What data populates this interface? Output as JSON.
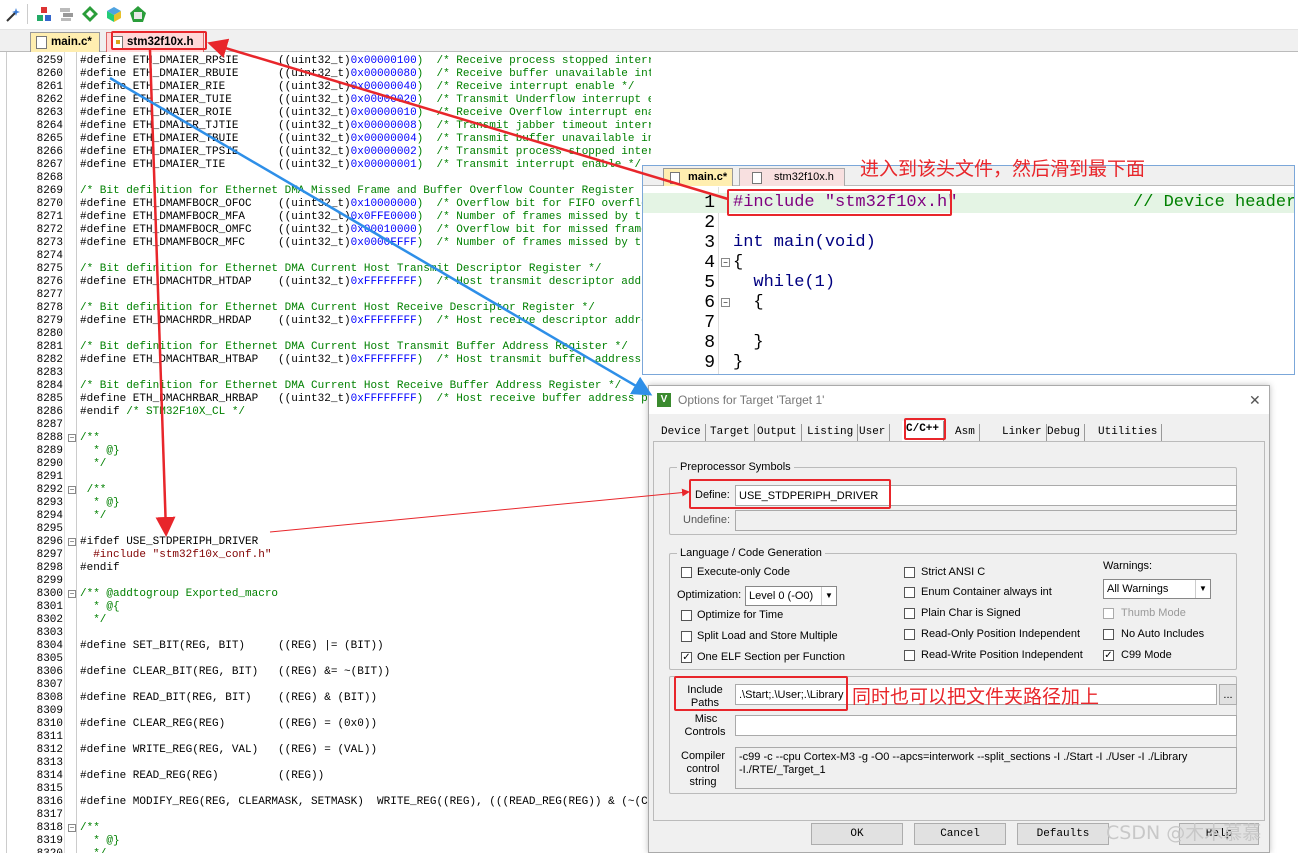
{
  "tabs": [
    {
      "label": "main.c*"
    },
    {
      "label": "stm32f10x.h"
    }
  ],
  "code_lines": [
    {
      "n": "8259",
      "t": "#define ETH_DMAIER_RPSIE      ((uint32_t)",
      "h": "0x00000100",
      "c": ")  /* Receive process stopped interrupt enable */"
    },
    {
      "n": "8260",
      "t": "#define ETH_DMAIER_RBUIE      ((uint32_t)",
      "h": "0x00000080",
      "c": ")  /* Receive buffer unavailable interrupt enable */"
    },
    {
      "n": "8261",
      "t": "#define ETH_DMAIER_RIE        ((uint32_t)",
      "h": "0x00000040",
      "c": ")  /* Receive interrupt enable */"
    },
    {
      "n": "8262",
      "t": "#define ETH_DMAIER_TUIE       ((uint32_t)",
      "h": "0x00000020",
      "c": ")  /* Transmit Underflow interrupt enable */"
    },
    {
      "n": "8263",
      "t": "#define ETH_DMAIER_ROIE       ((uint32_t)",
      "h": "0x00000010",
      "c": ")  /* Receive Overflow interrupt enable */"
    },
    {
      "n": "8264",
      "t": "#define ETH_DMAIER_TJTIE      ((uint32_t)",
      "h": "0x00000008",
      "c": ")  /* Transmit jabber timeout interrupt enable */"
    },
    {
      "n": "8265",
      "t": "#define ETH_DMAIER_TBUIE      ((uint32_t)",
      "h": "0x00000004",
      "c": ")  /* Transmit buffer unavailable interrupt enable */"
    },
    {
      "n": "8266",
      "t": "#define ETH_DMAIER_TPSIE      ((uint32_t)",
      "h": "0x00000002",
      "c": ")  /* Transmit process stopped interrupt enable */"
    },
    {
      "n": "8267",
      "t": "#define ETH_DMAIER_TIE        ((uint32_t)",
      "h": "0x00000001",
      "c": ")  /* Transmit interrupt enable */"
    },
    {
      "n": "8268",
      "t": "",
      "h": "",
      "c": ""
    },
    {
      "n": "8269",
      "t": "",
      "h": "",
      "c": "/* Bit definition for Ethernet DMA Missed Frame and Buffer Overflow Counter Register */"
    },
    {
      "n": "8270",
      "t": "#define ETH_DMAMFBOCR_OFOC    ((uint32_t)",
      "h": "0x10000000",
      "c": ")  /* Overflow bit for FIFO overflow counter */"
    },
    {
      "n": "8271",
      "t": "#define ETH_DMAMFBOCR_MFA     ((uint32_t)",
      "h": "0x0FFE0000",
      "c": ")  /* Number of frames missed by the application */"
    },
    {
      "n": "8272",
      "t": "#define ETH_DMAMFBOCR_OMFC    ((uint32_t)",
      "h": "0x00010000",
      "c": ")  /* Overflow bit for missed frame counter */"
    },
    {
      "n": "8273",
      "t": "#define ETH_DMAMFBOCR_MFC     ((uint32_t)",
      "h": "0x0000FFFF",
      "c": ")  /* Number of frames missed by the controller */"
    },
    {
      "n": "8274",
      "t": "",
      "h": "",
      "c": ""
    },
    {
      "n": "8275",
      "t": "",
      "h": "",
      "c": "/* Bit definition for Ethernet DMA Current Host Transmit Descriptor Register */"
    },
    {
      "n": "8276",
      "t": "#define ETH_DMACHTDR_HTDAP    ((uint32_t)",
      "h": "0xFFFFFFFF",
      "c": ")  /* Host transmit descriptor address pointer */"
    },
    {
      "n": "8277",
      "t": "",
      "h": "",
      "c": ""
    },
    {
      "n": "8278",
      "t": "",
      "h": "",
      "c": "/* Bit definition for Ethernet DMA Current Host Receive Descriptor Register */"
    },
    {
      "n": "8279",
      "t": "#define ETH_DMACHRDR_HRDAP    ((uint32_t)",
      "h": "0xFFFFFFFF",
      "c": ")  /* Host receive descriptor address pointer */"
    },
    {
      "n": "8280",
      "t": "",
      "h": "",
      "c": ""
    },
    {
      "n": "8281",
      "t": "",
      "h": "",
      "c": "/* Bit definition for Ethernet DMA Current Host Transmit Buffer Address Register */"
    },
    {
      "n": "8282",
      "t": "#define ETH_DMACHTBAR_HTBAP   ((uint32_t)",
      "h": "0xFFFFFFFF",
      "c": ")  /* Host transmit buffer address pointer */"
    },
    {
      "n": "8283",
      "t": "",
      "h": "",
      "c": ""
    },
    {
      "n": "8284",
      "t": "",
      "h": "",
      "c": "/* Bit definition for Ethernet DMA Current Host Receive Buffer Address Register */"
    },
    {
      "n": "8285",
      "t": "#define ETH_DMACHRBAR_HRBAP   ((uint32_t)",
      "h": "0xFFFFFFFF",
      "c": ")  /* Host receive buffer address pointer */"
    },
    {
      "n": "8286",
      "t": "#endif ",
      "h": "",
      "c": "/* STM32F10X_CL */"
    },
    {
      "n": "8287",
      "t": "",
      "h": "",
      "c": ""
    },
    {
      "n": "8288",
      "t": "/**",
      "h": "",
      "c": ""
    },
    {
      "n": "8289",
      "t": "  * @}",
      "h": "",
      "c": ""
    },
    {
      "n": "8290",
      "t": "  */",
      "h": "",
      "c": ""
    },
    {
      "n": "8291",
      "t": "",
      "h": "",
      "c": ""
    },
    {
      "n": "8292",
      "t": " /**",
      "h": "",
      "c": ""
    },
    {
      "n": "8293",
      "t": "  * @}",
      "h": "",
      "c": ""
    },
    {
      "n": "8294",
      "t": "  */",
      "h": "",
      "c": ""
    },
    {
      "n": "8295",
      "t": "",
      "h": "",
      "c": ""
    },
    {
      "n": "8296",
      "t": "#ifdef USE_STDPERIPH_DRIVER",
      "h": "",
      "c": ""
    },
    {
      "n": "8297",
      "t": "  #include \"stm32f10x_conf.h\"",
      "h": "",
      "c": ""
    },
    {
      "n": "8298",
      "t": "#endif",
      "h": "",
      "c": ""
    },
    {
      "n": "8299",
      "t": "",
      "h": "",
      "c": ""
    },
    {
      "n": "8300",
      "t": "/** @addtogroup Exported_macro",
      "h": "",
      "c": ""
    },
    {
      "n": "8301",
      "t": "  * @{",
      "h": "",
      "c": ""
    },
    {
      "n": "8302",
      "t": "  */",
      "h": "",
      "c": ""
    },
    {
      "n": "8303",
      "t": "",
      "h": "",
      "c": ""
    },
    {
      "n": "8304",
      "t": "#define SET_BIT(REG, BIT)     ((REG) |= (BIT))",
      "h": "",
      "c": ""
    },
    {
      "n": "8305",
      "t": "",
      "h": "",
      "c": ""
    },
    {
      "n": "8306",
      "t": "#define CLEAR_BIT(REG, BIT)   ((REG) &= ~(BIT))",
      "h": "",
      "c": ""
    },
    {
      "n": "8307",
      "t": "",
      "h": "",
      "c": ""
    },
    {
      "n": "8308",
      "t": "#define READ_BIT(REG, BIT)    ((REG) & (BIT))",
      "h": "",
      "c": ""
    },
    {
      "n": "8309",
      "t": "",
      "h": "",
      "c": ""
    },
    {
      "n": "8310",
      "t": "#define CLEAR_REG(REG)        ((REG) = (0x0))",
      "h": "",
      "c": ""
    },
    {
      "n": "8311",
      "t": "",
      "h": "",
      "c": ""
    },
    {
      "n": "8312",
      "t": "#define WRITE_REG(REG, VAL)   ((REG) = (VAL))",
      "h": "",
      "c": ""
    },
    {
      "n": "8313",
      "t": "",
      "h": "",
      "c": ""
    },
    {
      "n": "8314",
      "t": "#define READ_REG(REG)         ((REG))",
      "h": "",
      "c": ""
    },
    {
      "n": "8315",
      "t": "",
      "h": "",
      "c": ""
    },
    {
      "n": "8316",
      "t": "#define MODIFY_REG(REG, CLEARMASK, SETMASK)  WRITE_REG((REG), (((READ_REG(REG)) & (~(CLEARMASK))) | (SETMASK)))",
      "h": "",
      "c": ""
    },
    {
      "n": "8317",
      "t": "",
      "h": "",
      "c": ""
    },
    {
      "n": "8318",
      "t": "/**",
      "h": "",
      "c": ""
    },
    {
      "n": "8319",
      "t": "  * @}",
      "h": "",
      "c": ""
    },
    {
      "n": "8320",
      "t": "  */",
      "h": "",
      "c": ""
    }
  ],
  "win2": {
    "tabs": [
      "main.c*",
      "stm32f10x.h"
    ],
    "lines": [
      {
        "n": "1",
        "t": "#include \"stm32f10x.h\"",
        "c": "// Device header"
      },
      {
        "n": "2",
        "t": "",
        "c": ""
      },
      {
        "n": "3",
        "t": "int main(void)",
        "c": ""
      },
      {
        "n": "4",
        "t": "{",
        "c": ""
      },
      {
        "n": "5",
        "t": "  while(1)",
        "c": ""
      },
      {
        "n": "6",
        "t": "  {",
        "c": ""
      },
      {
        "n": "7",
        "t": "",
        "c": ""
      },
      {
        "n": "8",
        "t": "  }",
        "c": ""
      },
      {
        "n": "9",
        "t": "}",
        "c": ""
      }
    ]
  },
  "annotations": {
    "scroll_note": "进入到该头文件，然后滑到最下面",
    "path_note": "同时也可以把文件夹路径加上"
  },
  "dialog": {
    "title": "Options for Target 'Target 1'",
    "close": "✕",
    "tabs": [
      "Device",
      "Target",
      "Output",
      "Listing",
      "User",
      "C/C++",
      "Asm",
      "Linker",
      "Debug",
      "Utilities"
    ],
    "preproc_group": "Preprocessor Symbols",
    "define_label": "Define:",
    "define_value": "USE_STDPERIPH_DRIVER",
    "undefine_label": "Undefine:",
    "undefine_value": "",
    "langgen_group": "Language / Code Generation",
    "execute_only": "Execute-only Code",
    "optimization_label": "Optimization:",
    "optimization_value": "Level 0 (-O0)",
    "optimize_time": "Optimize for Time",
    "split_load": "Split Load and Store Multiple",
    "one_elf": "One ELF Section per Function",
    "strict_ansi": "Strict ANSI C",
    "enum_container": "Enum Container always int",
    "plain_char": "Plain Char is Signed",
    "ro_pos": "Read-Only Position Independent",
    "rw_pos": "Read-Write Position Independent",
    "warnings_label": "Warnings:",
    "warnings_value": "All Warnings",
    "thumb_mode": "Thumb Mode",
    "no_auto": "No Auto Includes",
    "c99": "C99 Mode",
    "include_label1": "Include",
    "include_label2": "Paths",
    "include_value": ".\\Start;.\\User;.\\Library",
    "browse": "...",
    "misc_label1": "Misc",
    "misc_label2": "Controls",
    "misc_value": "",
    "compiler_label1": "Compiler",
    "compiler_label2": "control",
    "compiler_label3": "string",
    "compiler_line1": "-c99 -c --cpu Cortex-M3 -g -O0 --apcs=interwork --split_sections -I ./Start -I ./User -I ./Library",
    "compiler_line2": "-I./RTE/_Target_1",
    "ok": "OK",
    "cancel": "Cancel",
    "defaults": "Defaults",
    "help": "Help"
  },
  "watermark": "CSDN @木木慕慕"
}
